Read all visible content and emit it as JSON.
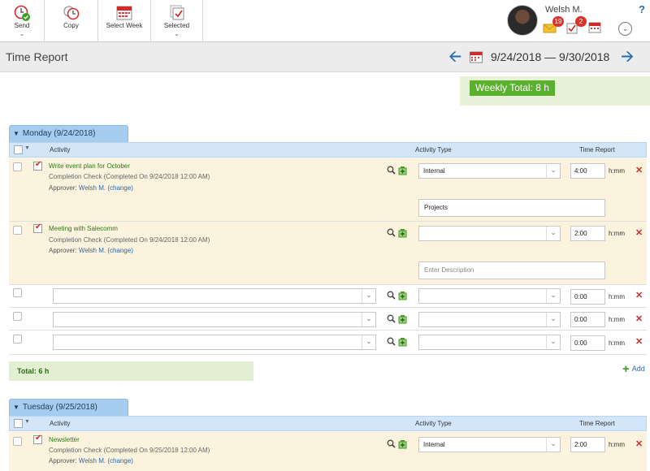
{
  "toolbar": {
    "send_label": "Send",
    "copy_label": "Copy",
    "select_week_label": "Select Week",
    "selected_label": "Selected"
  },
  "user": {
    "name": "Welsh M.",
    "mail_count": "19",
    "tasks_count": "2",
    "help": "?"
  },
  "header": {
    "title": "Time Report",
    "date_range": "9/24/2018 — 9/30/2018"
  },
  "weekly_total": "Weekly Total: 8 h",
  "columns": {
    "activity": "Activity",
    "activity_type": "Activity Type",
    "time_report": "Time Report"
  },
  "days": [
    {
      "label": "Monday (9/24/2018)",
      "entries": [
        {
          "title": "Write event plan for October",
          "subtitle": "Completion Check (Completed On 9/24/2018 12:00 AM)",
          "approver_label": "Approver:",
          "approver": "Welsh M.",
          "change": "(change)",
          "type": "Internal",
          "description": "Projects",
          "time": "4:00",
          "unit": "h:mm"
        },
        {
          "title": "Meeting with Salecomm",
          "subtitle": "Completion Check (Completed On 9/24/2018 12:00 AM)",
          "approver_label": "Approver:",
          "approver": "Welsh M.",
          "change": "(change)",
          "type": "",
          "description_placeholder": "Enter Description",
          "time": "2:00",
          "unit": "h:mm"
        }
      ],
      "empty_rows": [
        {
          "time": "0:00",
          "unit": "h:mm"
        },
        {
          "time": "0:00",
          "unit": "h:mm"
        },
        {
          "time": "0:00",
          "unit": "h:mm"
        }
      ],
      "total": "Total: 6 h",
      "add_label": "Add"
    },
    {
      "label": "Tuesday (9/25/2018)",
      "entries": [
        {
          "title": "Newsletter",
          "subtitle": "Completion Check (Completed On 9/25/2018 12:00 AM)",
          "approver_label": "Approver:",
          "approver": "Welsh M.",
          "change": "(change)",
          "type": "Internal",
          "time": "2:00",
          "unit": "h:mm"
        }
      ]
    }
  ],
  "icons": {
    "send": "clock-check-icon",
    "copy": "clocks-copy-icon",
    "select_week": "calendar-icon",
    "selected": "stacked-check-icon",
    "search": "magnifier-icon",
    "add_contact": "add-icon",
    "delete": "x-icon"
  },
  "colors": {
    "accent_blue": "#1e6bb8",
    "day_tab": "#a6cdf0",
    "entry_bg": "#fbf3de",
    "weekly_chip": "#5ab12e",
    "delete_red": "#d12a2a"
  }
}
